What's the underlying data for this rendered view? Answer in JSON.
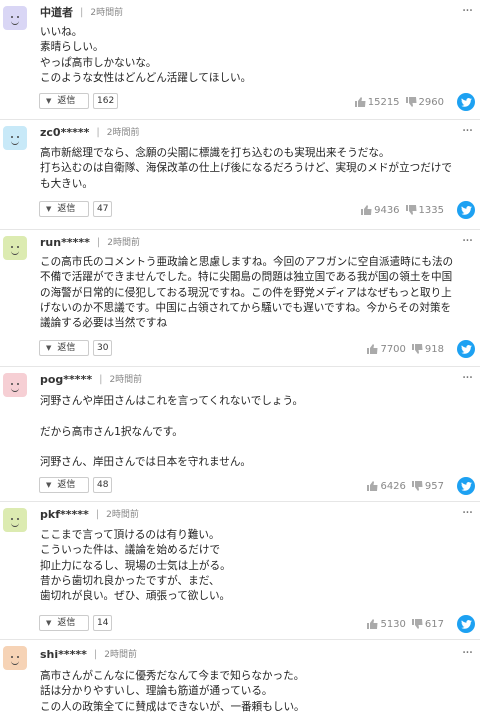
{
  "icons": {
    "avatar": "face-avatar-icon",
    "more": "more-options-icon",
    "reply_caret": "caret-down-icon",
    "like": "thumbs-up-icon",
    "dislike": "thumbs-down-icon",
    "share": "twitter-icon"
  },
  "colors": {
    "twitter": "#1da1f2",
    "avatar_purple": "#d9d6f5",
    "avatar_blue": "#c8e9f8",
    "avatar_green": "#dcebb1",
    "avatar_pink": "#f6cfd4",
    "avatar_orange": "#f6d3b6"
  },
  "reply_label": "返信",
  "more_label": "···",
  "comments": [
    {
      "user": "中道者",
      "time": "2時間前",
      "text": "いいね。\n素晴らしい。\nやっぱ高市しかないな。\nこのような女性はどんどん活躍してほしい。",
      "replies": "162",
      "likes": "15215",
      "dislikes": "2960"
    },
    {
      "user": "zc0*****",
      "time": "2時間前",
      "text": "高市新総理でなら、念願の尖閣に標識を打ち込むのも実現出来そうだな。\n打ち込むのは自衛隊、海保改革の仕上げ後になるだろうけど、実現のメドが立つだけで\nも大きい。",
      "replies": "47",
      "likes": "9436",
      "dislikes": "1335"
    },
    {
      "user": "run*****",
      "time": "2時間前",
      "text": "この高市氏のコメントう亜政論と思慮しますね。今回のアフガンに空自派遣時にも法の\n不備で活躍ができませんでした。特に尖閣島の問題は独立国である我が国の領土を中国\nの海警が日常的に侵犯しておる現況ですね。この件を野党メディアはなぜもっと取り上\nげないのか不思議です。中国に占領されてから騒いでも遅いですね。今からその対策を\n議論する必要は当然ですね",
      "replies": "30",
      "likes": "7700",
      "dislikes": "918"
    },
    {
      "user": "pog*****",
      "time": "2時間前",
      "text": "河野さんや岸田さんはこれを言ってくれないでしょう。\n\nだから高市さん1択なんです。\n\n河野さん、岸田さんでは日本を守れません。",
      "replies": "48",
      "likes": "6426",
      "dislikes": "957"
    },
    {
      "user": "pkf*****",
      "time": "2時間前",
      "text": "ここまで言って頂けるのは有り難い。\nこういった件は、議論を始めるだけで\n抑止力になるし、現場の士気は上がる。\n昔から歯切れ良かったですが、まだ、\n歯切れが良い。ぜひ、頑張って欲しい。",
      "replies": "14",
      "likes": "5130",
      "dislikes": "617"
    },
    {
      "user": "shi*****",
      "time": "2時間前",
      "text": "高市さんがこんなに優秀だなんて今まで知らなかった。\n話は分かりやすいし、理論も筋道が通っている。\nこの人の政策全てに賛成はできないが、一番頼もしい。",
      "replies": "",
      "likes": "",
      "dislikes": ""
    }
  ]
}
